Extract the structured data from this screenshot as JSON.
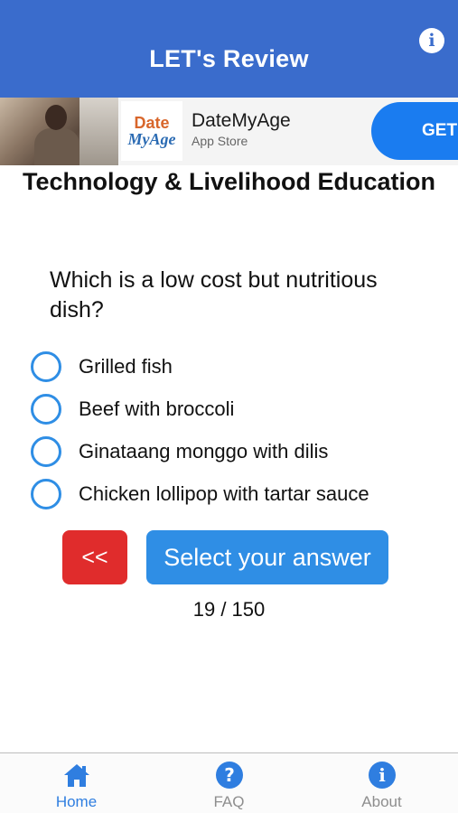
{
  "header": {
    "title": "LET's Review",
    "info_icon": "info-icon"
  },
  "ad": {
    "logo_line1": "Date",
    "logo_line2": "MyAge",
    "app_name": "DateMyAge",
    "store": "App Store",
    "cta": "GET"
  },
  "subject": "Technology & Livelihood Education",
  "question": {
    "text": "Which is a low cost but nutritious dish?",
    "options": [
      {
        "label": "Grilled fish"
      },
      {
        "label": "Beef with broccoli"
      },
      {
        "label": "Ginataang monggo with dilis"
      },
      {
        "label": "Chicken lollipop with tartar sauce"
      }
    ]
  },
  "controls": {
    "back_label": "<<",
    "submit_label": "Select your answer",
    "progress": "19 / 150"
  },
  "tabs": [
    {
      "label": "Home",
      "icon": "home-icon",
      "active": true
    },
    {
      "label": "FAQ",
      "icon": "question-circle-icon",
      "active": false
    },
    {
      "label": "About",
      "icon": "info-circle-icon",
      "active": false
    }
  ],
  "colors": {
    "header_bg": "#3a6ccc",
    "accent_blue": "#2f8ee5",
    "back_red": "#e02c2c",
    "tab_active": "#2f7ee0",
    "tab_inactive": "#8e8e8e"
  }
}
